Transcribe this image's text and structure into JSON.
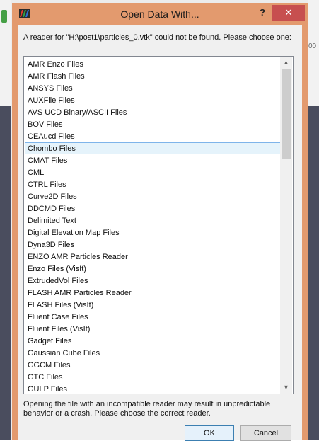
{
  "background": {
    "right_text": "00"
  },
  "dialog": {
    "title": "Open Data With...",
    "help_label": "?",
    "close_label": "✕",
    "message": "A reader for \"H:\\post1\\particles_0.vtk\" could not be found.  Please choose one:",
    "warning": "Opening the file with an incompatible reader may result in unpredictable behavior or a crash.  Please choose the correct reader.",
    "ok_label": "OK",
    "cancel_label": "Cancel",
    "selected_index": 7
  },
  "readers": [
    "AMR Enzo Files",
    "AMR Flash Files",
    "ANSYS Files",
    "AUXFile Files",
    "AVS UCD Binary/ASCII Files",
    "BOV Files",
    "CEAucd Files",
    "Chombo Files",
    "CMAT Files",
    "CML",
    "CTRL Files",
    "Curve2D Files",
    "DDCMD Files",
    "Delimited Text",
    "Digital Elevation Map Files",
    "Dyna3D Files",
    "ENZO AMR Particles Reader",
    "Enzo Files (VisIt)",
    "ExtrudedVol Files",
    "FLASH AMR Particles Reader",
    "FLASH Files (VisIt)",
    "Fluent Case Files",
    "Fluent Files (VisIt)",
    "Gadget Files",
    "Gaussian Cube Files",
    "GGCM Files",
    "GTC Files",
    "GULP Files"
  ],
  "scroll": {
    "up_icon": "▲",
    "down_icon": "▼"
  },
  "colors": {
    "dialog_frame": "#e39a6e",
    "close_button": "#c74f4f",
    "selection_fill": "#e5f3fb",
    "selection_border": "#7eb4ea"
  }
}
